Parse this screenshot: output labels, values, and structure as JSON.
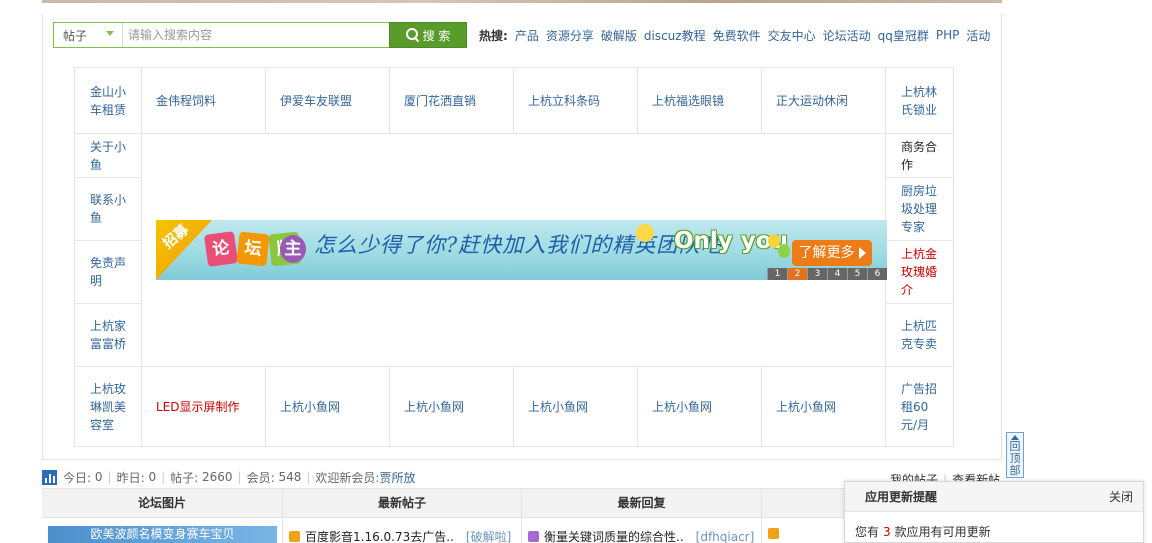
{
  "search": {
    "scope": "帖子",
    "placeholder": "请输入搜索内容",
    "button": "搜 索"
  },
  "hot": {
    "label": "热搜:",
    "links": [
      "产品",
      "资源分享",
      "破解版",
      "discuz教程",
      "免费软件",
      "交友中心",
      "论坛活动",
      "qq皇冠群",
      "PHP",
      "活动"
    ]
  },
  "links": {
    "row1": [
      "金山小车租赁",
      "金伟程饲料",
      "伊爱车友联盟",
      "厦门花洒直销",
      "上杭立科条码",
      "上杭福选眼镜",
      "正大运动休闲",
      "上杭林氏锁业"
    ],
    "left_side": [
      "关于小鱼",
      "联系小鱼",
      "免责声明",
      "上杭家富富桥"
    ],
    "right_side": [
      "商务合作",
      "厨房垃圾处理专家",
      "上杭金玫瑰婚介",
      "上杭匹克专卖"
    ],
    "row_last": [
      "上杭玫琳凯美容室",
      "LED显示屏制作",
      "上杭小鱼网",
      "上杭小鱼网",
      "上杭小鱼网",
      "上杭小鱼网",
      "上杭小鱼网",
      "广告招租60元/月"
    ]
  },
  "banner": {
    "corner": "招募",
    "tags": [
      "论",
      "坛",
      "版",
      "主"
    ],
    "slogan": "怎么少得了你?赶快加入我们的精英团队吧!",
    "highlight": "Only you",
    "cta": "了解更多",
    "pages": [
      "1",
      "2",
      "3",
      "4",
      "5",
      "6"
    ],
    "active_page": "2",
    "colors": {
      "tag1": "#e94e77",
      "tag2": "#f39800",
      "tag3": "#8cc63f",
      "tag4": "#9b59b6"
    }
  },
  "stats": {
    "today_label": "今日:",
    "today": "0",
    "yesterday_label": "昨日:",
    "yesterday": "0",
    "posts_label": "帖子:",
    "posts": "2660",
    "members_label": "会员:",
    "members": "548",
    "welcome_label": "欢迎新会员:",
    "newest_member": "贾所放"
  },
  "my_links": {
    "my_posts": "我的帖子",
    "view_new": "查看新帖"
  },
  "back_to_top": "回顶部",
  "tabs": {
    "headers": [
      "论坛图片",
      "最新帖子",
      "最新回复",
      ""
    ],
    "picture_caption": "欧美波颜名模变身赛车宝贝",
    "latest_post": {
      "title": "百度影音1.16.0.73去广告..",
      "category": "[破解啦]"
    },
    "latest_reply": {
      "title": "衡量关键词质量的综合性..",
      "author": "[dfhqiacr]"
    }
  },
  "notice": {
    "title": "应用更新提醒",
    "close": "关闭",
    "text_before": "您有",
    "count": "3",
    "text_after": "款应用有可用更新"
  }
}
